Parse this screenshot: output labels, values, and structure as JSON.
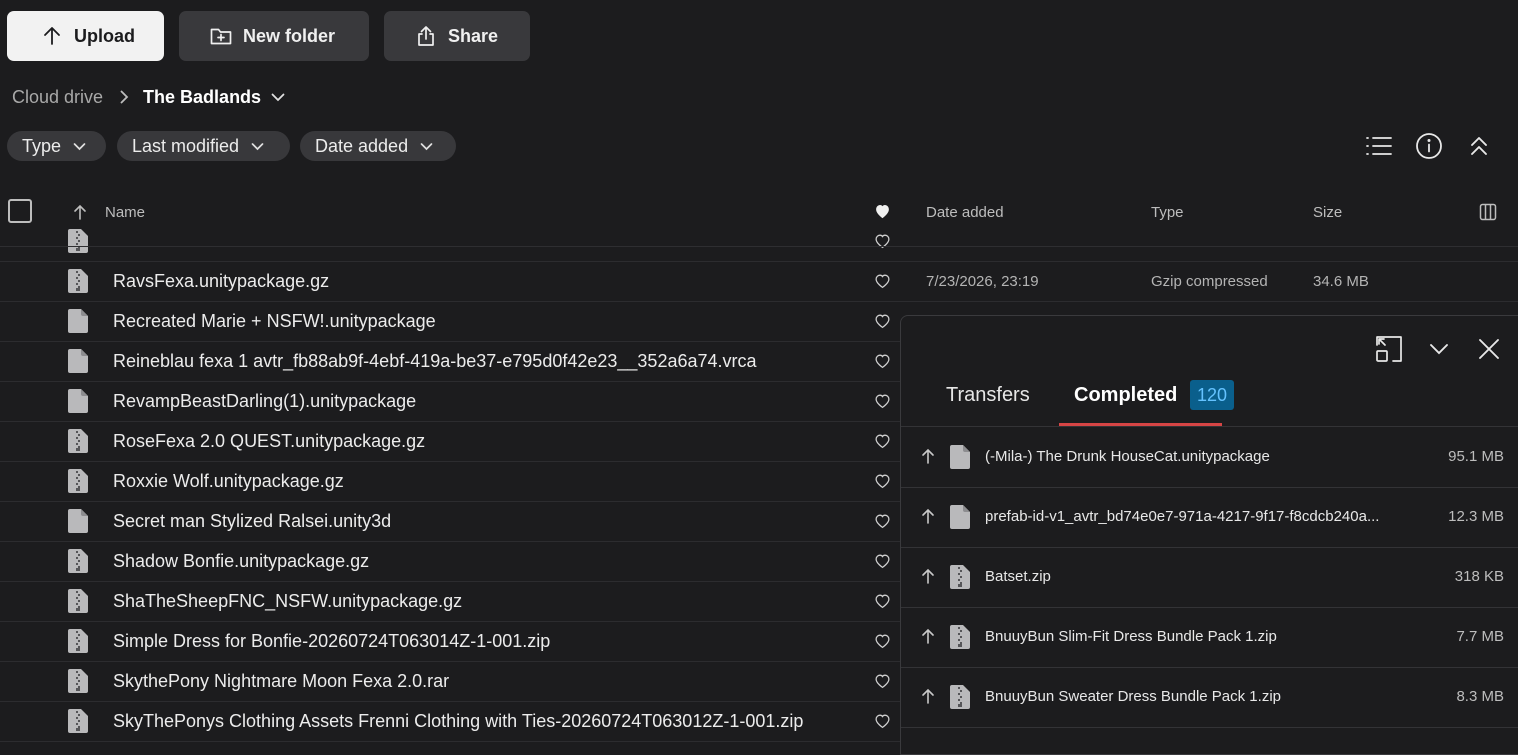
{
  "toolbar": {
    "upload_label": "Upload",
    "new_folder_label": "New folder",
    "share_label": "Share"
  },
  "breadcrumb": {
    "root": "Cloud drive",
    "current": "The Badlands"
  },
  "filters": [
    {
      "label": "Type"
    },
    {
      "label": "Last modified"
    },
    {
      "label": "Date added"
    }
  ],
  "table": {
    "headers": {
      "name": "Name",
      "date_added": "Date added",
      "type": "Type",
      "size": "Size"
    },
    "rows": [
      {
        "name": "",
        "icon": "zip-file-icon",
        "date": "",
        "type": "",
        "size": ""
      },
      {
        "name": "RavsFexa.unitypackage.gz",
        "icon": "zip-file-icon",
        "date": "7/23/2026, 23:19",
        "type": "Gzip compressed",
        "size": "34.6 MB"
      },
      {
        "name": "Recreated Marie + NSFW!.unitypackage",
        "icon": "file-icon",
        "date": "",
        "type": "",
        "size": ""
      },
      {
        "name": "Reineblau fexa 1 avtr_fb88ab9f-4ebf-419a-be37-e795d0f42e23__352a6a74.vrca",
        "icon": "file-icon",
        "date": "",
        "type": "",
        "size": ""
      },
      {
        "name": "RevampBeastDarling(1).unitypackage",
        "icon": "file-icon",
        "date": "",
        "type": "",
        "size": ""
      },
      {
        "name": "RoseFexa 2.0 QUEST.unitypackage.gz",
        "icon": "zip-file-icon",
        "date": "",
        "type": "",
        "size": ""
      },
      {
        "name": "Roxxie Wolf.unitypackage.gz",
        "icon": "zip-file-icon",
        "date": "",
        "type": "",
        "size": ""
      },
      {
        "name": "Secret man Stylized Ralsei.unity3d",
        "icon": "file-icon",
        "date": "",
        "type": "",
        "size": ""
      },
      {
        "name": "Shadow Bonfie.unitypackage.gz",
        "icon": "zip-file-icon",
        "date": "",
        "type": "",
        "size": ""
      },
      {
        "name": "ShaTheSheepFNC_NSFW.unitypackage.gz",
        "icon": "zip-file-icon",
        "date": "",
        "type": "",
        "size": ""
      },
      {
        "name": "Simple Dress for Bonfie-20260724T063014Z-1-001.zip",
        "icon": "zip-file-icon",
        "date": "",
        "type": "",
        "size": ""
      },
      {
        "name": "SkythePony Nightmare Moon Fexa 2.0.rar",
        "icon": "zip-file-icon",
        "date": "",
        "type": "",
        "size": ""
      },
      {
        "name": "SkyThePonys Clothing Assets Frenni Clothing with Ties-20260724T063012Z-1-001.zip",
        "icon": "zip-file-icon",
        "date": "",
        "type": "",
        "size": ""
      }
    ]
  },
  "transfers_panel": {
    "tab_transfers": "Transfers",
    "tab_completed": "Completed",
    "completed_count": "120",
    "items": [
      {
        "name": "(-Mila-) The Drunk HouseCat.unitypackage",
        "icon": "file-icon",
        "size": "95.1 MB"
      },
      {
        "name": "prefab-id-v1_avtr_bd74e0e7-971a-4217-9f17-f8cdcb240a...",
        "icon": "file-icon",
        "size": "12.3 MB"
      },
      {
        "name": "Batset.zip",
        "icon": "zip-file-icon",
        "size": "318 KB"
      },
      {
        "name": "BnuuyBun Slim-Fit Dress Bundle Pack 1.zip",
        "icon": "zip-file-icon",
        "size": "7.7 MB"
      },
      {
        "name": "BnuuyBun Sweater Dress Bundle Pack 1.zip",
        "icon": "zip-file-icon",
        "size": "8.3 MB"
      }
    ]
  },
  "colors": {
    "background": "#1c1c1e",
    "accent_underline": "#d64545",
    "badge_bg": "#0a5f8c",
    "badge_text": "#64c2ff"
  }
}
